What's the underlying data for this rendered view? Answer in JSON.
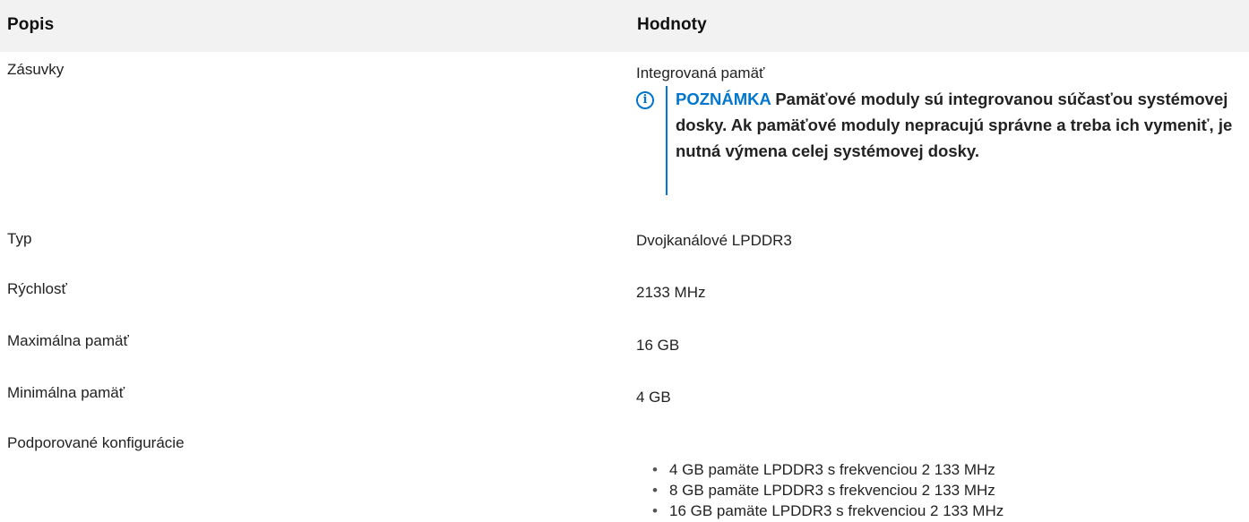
{
  "header": {
    "col1": "Popis",
    "col2": "Hodnoty"
  },
  "rows": [
    {
      "label": "Zásuvky",
      "value": "Integrovaná pamäť",
      "note": {
        "icon": "info-icon",
        "label": "POZNÁMKA",
        "text": "Pamäťové moduly sú integrovanou súčasťou systémovej dosky. Ak pamäťové moduly nepracujú správne a treba ich vymeniť, je nutná výmena celej systémovej dosky."
      }
    },
    {
      "label": "Typ",
      "value": "Dvojkanálové LPDDR3"
    },
    {
      "label": "Rýchlosť",
      "value": "2133 MHz"
    },
    {
      "label": "Maximálna pamäť",
      "value": "16 GB"
    },
    {
      "label": "Minimálna pamäť",
      "value": "4 GB"
    },
    {
      "label": "Podporované konfigurácie",
      "items": [
        "4 GB pamäte LPDDR3 s frekvenciou 2 133 MHz",
        "8 GB pamäte LPDDR3 s frekvenciou 2 133 MHz",
        "16 GB pamäte LPDDR3 s frekvenciou 2 133 MHz"
      ]
    }
  ],
  "colors": {
    "header_bg": "#f2f2f2",
    "note_accent": "#0076ce",
    "text": "#222222"
  }
}
